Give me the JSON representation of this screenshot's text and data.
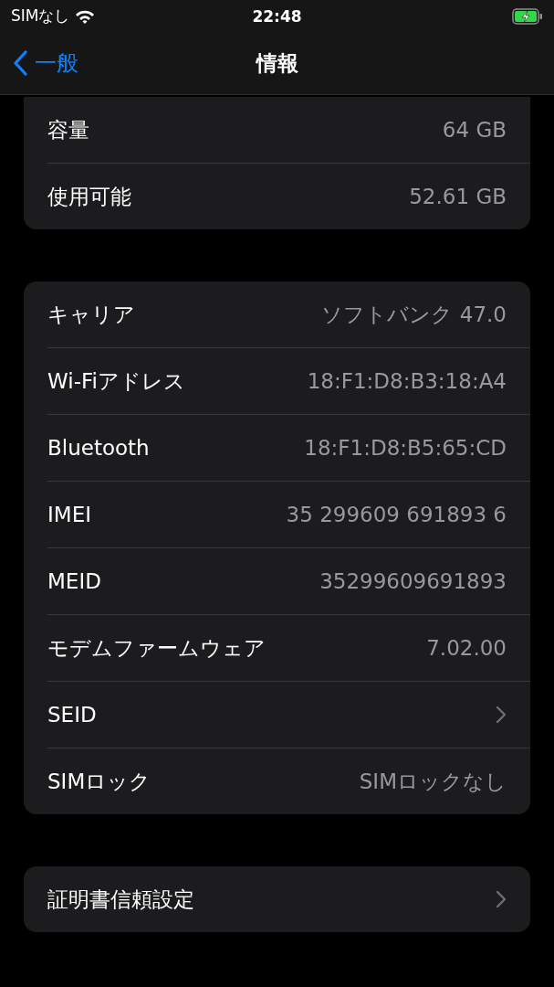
{
  "status_bar": {
    "carrier": "SIMなし",
    "time": "22:48"
  },
  "nav": {
    "back_label": "一般",
    "title": "情報"
  },
  "groups": [
    {
      "rows": [
        {
          "kind": "value",
          "label": "容量",
          "value": "64 GB"
        },
        {
          "kind": "value",
          "label": "使用可能",
          "value": "52.61 GB"
        }
      ]
    },
    {
      "rows": [
        {
          "kind": "value",
          "label": "キャリア",
          "value": "ソフトバンク 47.0"
        },
        {
          "kind": "value",
          "label": "Wi-Fiアドレス",
          "value": "18:F1:D8:B3:18:A4"
        },
        {
          "kind": "value",
          "label": "Bluetooth",
          "value": "18:F1:D8:B5:65:CD"
        },
        {
          "kind": "value",
          "label": "IMEI",
          "value": "35 299609 691893 6"
        },
        {
          "kind": "value",
          "label": "MEID",
          "value": "35299609691893"
        },
        {
          "kind": "value",
          "label": "モデムファームウェア",
          "value": "7.02.00"
        },
        {
          "kind": "link",
          "label": "SEID"
        },
        {
          "kind": "value",
          "label": "SIMロック",
          "value": "SIMロックなし"
        }
      ]
    },
    {
      "rows": [
        {
          "kind": "link",
          "label": "証明書信頼設定"
        }
      ]
    }
  ]
}
